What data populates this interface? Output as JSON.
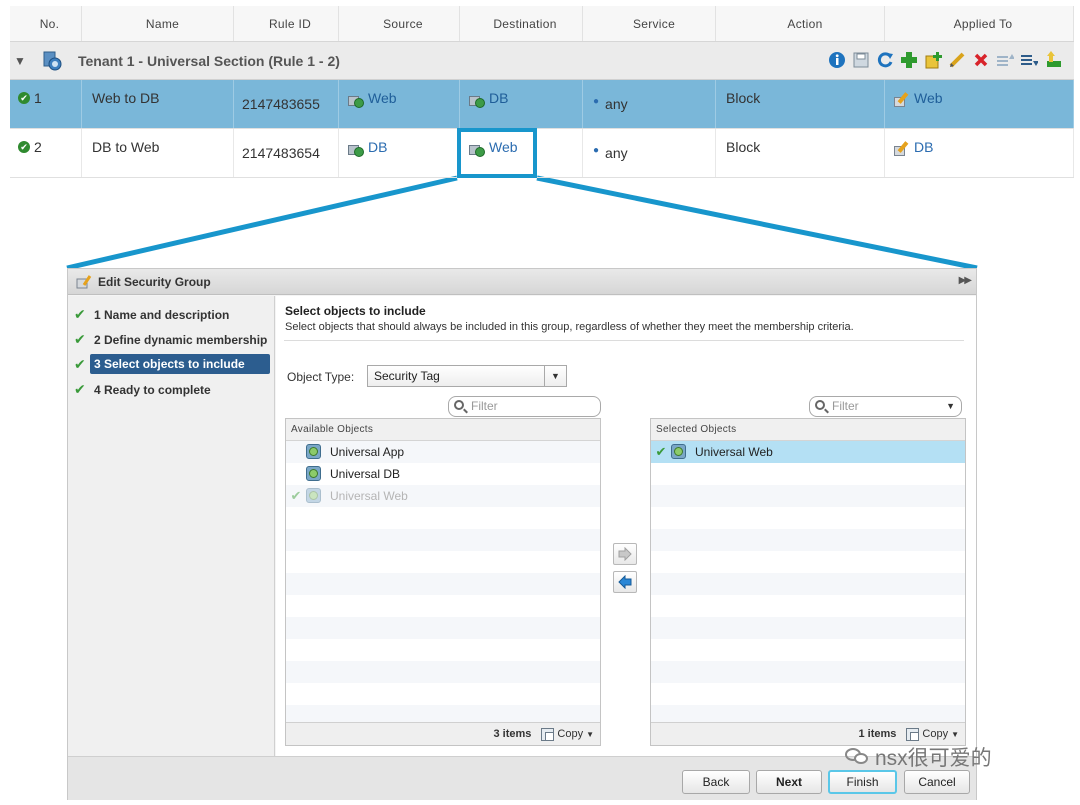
{
  "table": {
    "headers": [
      "No.",
      "Name",
      "Rule ID",
      "Source",
      "Destination",
      "Service",
      "Action",
      "Applied To"
    ],
    "section_title": "Tenant 1 - Universal Section (Rule 1 - 2)",
    "rows": [
      {
        "no": "1",
        "name": "Web to DB",
        "rule_id": "2147483655",
        "source": "Web",
        "destination": "DB",
        "service": "any",
        "action": "Block",
        "applied_to": "Web"
      },
      {
        "no": "2",
        "name": "DB to Web",
        "rule_id": "2147483654",
        "source": "DB",
        "destination": "Web",
        "service": "any",
        "action": "Block",
        "applied_to": "DB"
      }
    ]
  },
  "toolbar_icons": [
    "info-icon",
    "save-icon",
    "refresh-icon",
    "add-icon",
    "add-section-icon",
    "edit-icon",
    "delete-icon",
    "move-up-icon",
    "move-down-icon",
    "publish-icon"
  ],
  "wizard": {
    "title": "Edit Security Group",
    "collapse_glyph": "▶▶",
    "steps": [
      {
        "label": "1  Name and description"
      },
      {
        "label": "2  Define dynamic membership"
      },
      {
        "label": "3  Select objects to include"
      },
      {
        "label": "4  Ready to complete"
      }
    ],
    "content_title": "Select objects to include",
    "content_subtitle": "Select objects that should always be included in this group, regardless of whether they meet the membership criteria.",
    "object_type_label": "Object Type:",
    "object_type_value": "Security Tag",
    "filter_placeholder": "Filter",
    "available": {
      "header": "Available Objects",
      "items": [
        {
          "label": "Universal App",
          "selected": false
        },
        {
          "label": "Universal DB",
          "selected": false
        },
        {
          "label": "Universal Web",
          "selected": true
        }
      ],
      "count": "3 items",
      "copy": "Copy"
    },
    "selected": {
      "header": "Selected Objects",
      "items": [
        {
          "label": "Universal Web"
        }
      ],
      "count": "1 items",
      "copy": "Copy"
    },
    "buttons": {
      "back": "Back",
      "next": "Next",
      "finish": "Finish",
      "cancel": "Cancel"
    }
  },
  "watermark": "nsx很可爱的",
  "colors": {
    "selected_row": "#7ab7d9",
    "highlight": "#1896cc",
    "active_step": "#2c5d8f"
  }
}
